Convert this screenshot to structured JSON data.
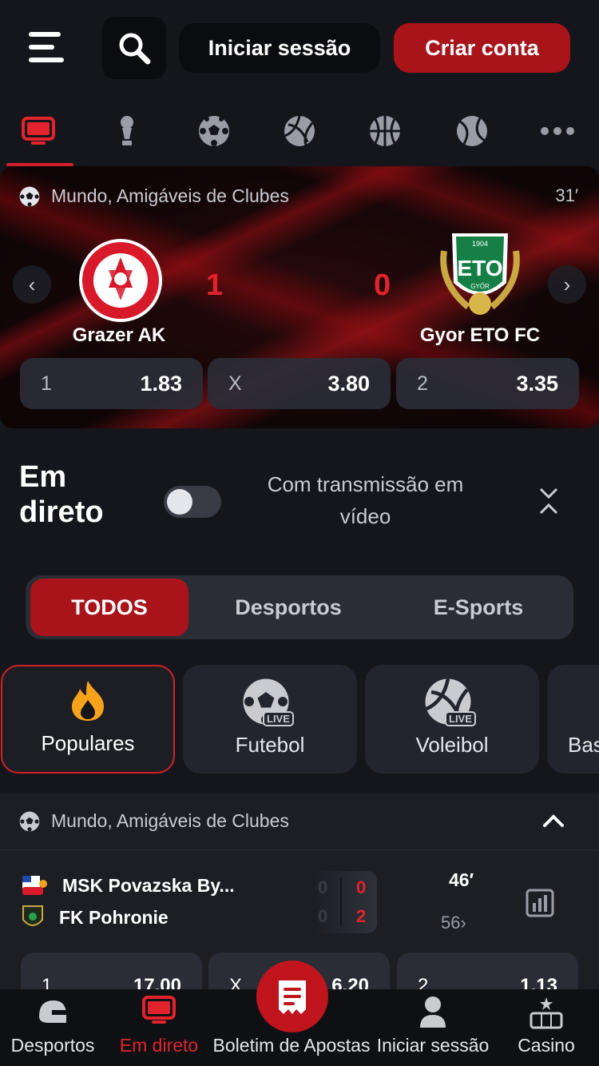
{
  "header": {
    "login_label": "Iniciar sessão",
    "register_label": "Criar conta"
  },
  "sport_tabs": [
    {
      "icon": "live-tv-icon",
      "active": true
    },
    {
      "icon": "trophy-icon"
    },
    {
      "icon": "soccer-ball-icon"
    },
    {
      "icon": "volleyball-icon"
    },
    {
      "icon": "basketball-icon"
    },
    {
      "icon": "tennis-ball-icon"
    },
    {
      "icon": "more-dots-icon"
    }
  ],
  "featured": {
    "league": "Mundo, Amigáveis de Clubes",
    "minute": "31′",
    "home": {
      "name": "Grazer AK",
      "score": "1"
    },
    "away": {
      "name": "Gyor ETO FC",
      "score": "0",
      "logo_text": "ETO",
      "logo_year": "1904",
      "logo_city": "GYŐR"
    },
    "odds": [
      {
        "label": "1",
        "value": "1.83"
      },
      {
        "label": "X",
        "value": "3.80"
      },
      {
        "label": "2",
        "value": "3.35"
      }
    ]
  },
  "live": {
    "title": "Em direto",
    "toggle_label": "Com transmissão em vídeo",
    "toggle_on": false
  },
  "segments": [
    "TODOS",
    "Desportos",
    "E-Sports"
  ],
  "categories": [
    {
      "label": "Populares",
      "icon": "fire-icon"
    },
    {
      "label": "Futebol",
      "icon": "soccer-live-icon",
      "badge": "LIVE"
    },
    {
      "label": "Voleibol",
      "icon": "volleyball-live-icon",
      "badge": "LIVE"
    },
    {
      "label": "Bas",
      "icon": "basketball-live-icon"
    }
  ],
  "league_section": {
    "league": "Mundo, Amigáveis de Clubes",
    "match": {
      "home": "MSK Povazska By...",
      "away": "FK Pohronie",
      "home_score": "0",
      "away_score": "2",
      "home_prev": "0",
      "away_prev": "0",
      "minute": "46′",
      "more_markets": "56",
      "odds": [
        {
          "label": "1",
          "value": "17.00"
        },
        {
          "label": "X",
          "value": "6.20"
        },
        {
          "label": "2",
          "value": "1.13"
        }
      ]
    }
  },
  "bottom_nav": [
    {
      "label": "Desportos",
      "icon": "helmet-icon"
    },
    {
      "label": "Em direto",
      "icon": "live-tv-icon",
      "active": true
    },
    {
      "label": "Boletim de Apostas",
      "icon": "betslip-icon"
    },
    {
      "label": "Iniciar sessão",
      "icon": "user-icon"
    },
    {
      "label": "Casino",
      "icon": "slot-machine-icon"
    }
  ],
  "colors": {
    "accent": "#a8141a",
    "live_red": "#e2232b",
    "background": "#14161b"
  }
}
